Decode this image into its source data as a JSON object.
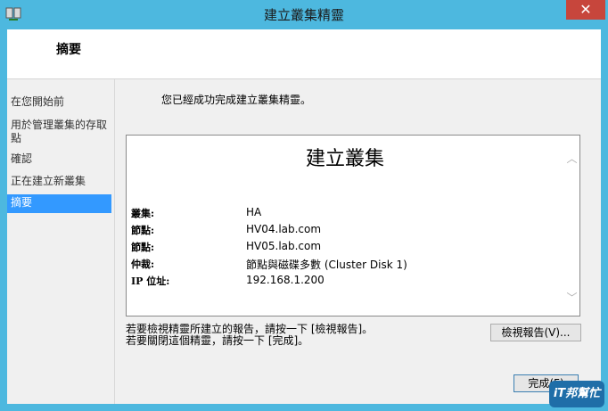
{
  "window": {
    "title": "建立叢集精靈",
    "close_symbol": "✕"
  },
  "header": {
    "title": "摘要"
  },
  "nav": {
    "items": [
      {
        "label": "在您開始前"
      },
      {
        "label": "用於管理叢集的存取點"
      },
      {
        "label": "確認"
      },
      {
        "label": "正在建立新叢集"
      },
      {
        "label": "摘要"
      }
    ]
  },
  "content": {
    "success_message": "您已經成功完成建立叢集精靈。",
    "report": {
      "title": "建立叢集",
      "rows": [
        {
          "label": "叢集:",
          "value": "HA"
        },
        {
          "label": "節點:",
          "value": "HV04.lab.com"
        },
        {
          "label": "節點:",
          "value": "HV05.lab.com"
        },
        {
          "label": "仲裁:",
          "value": "節點與磁碟多數 (Cluster Disk 1)"
        },
        {
          "label": "IP 位址:",
          "value": "192.168.1.200"
        }
      ]
    },
    "hint_line1": "若要檢視精靈所建立的報告，請按一下 [檢視報告]。",
    "hint_line2": "若要關閉這個精靈，請按一下 [完成]。",
    "view_report_label": "檢視報告(V)...",
    "finish_label": "完成(F)"
  },
  "watermark": {
    "text": "iT邦幫忙"
  },
  "colors": {
    "titlebar": "#4db8df",
    "close": "#c7463c",
    "nav_active": "#3399ff"
  }
}
